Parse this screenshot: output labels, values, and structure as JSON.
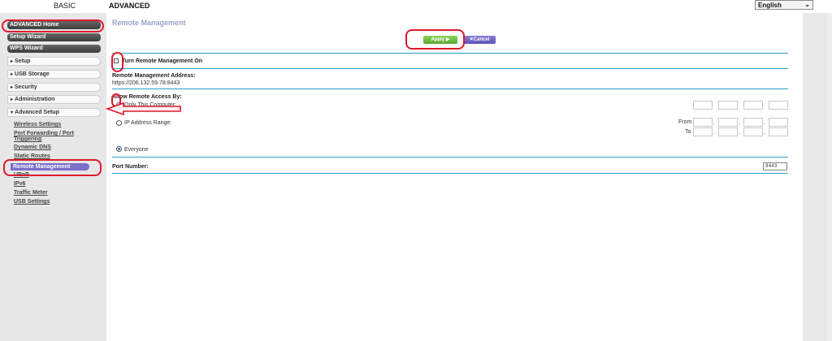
{
  "tabs": {
    "basic": "BASIC",
    "advanced": "ADVANCED"
  },
  "language": {
    "selected": "English"
  },
  "sidebar": {
    "dark_buttons": [
      "ADVANCED Home",
      "Setup Wizard",
      "WPS Wizard"
    ],
    "menu": [
      {
        "label": "Setup",
        "arrow": "▸"
      },
      {
        "label": "USB Storage",
        "arrow": "▸"
      },
      {
        "label": "Security",
        "arrow": "▸"
      },
      {
        "label": "Administration",
        "arrow": "▸"
      },
      {
        "label": "Advanced Setup",
        "arrow": "▾"
      }
    ],
    "sub_items": [
      "Wireless Settings",
      "Port Forwarding / Port",
      "Triggering",
      "Dynamic DNS",
      "Static Routes",
      "Remote Management",
      "UPnP",
      "IPv6",
      "Traffic Meter",
      "USB Settings"
    ]
  },
  "main": {
    "title": "Remote Management",
    "apply_label": "Apply ▶",
    "cancel_label": "✕Cancel",
    "turn_on_label": "Turn Remote Management On",
    "turn_on_checked": false,
    "address_label": "Remote Management Address:",
    "address_value": "https://206.132.59.78:8443",
    "access_label": "Allow Remote Access By:",
    "options": [
      "Only This Computer:",
      "IP Address Range:",
      "Everyone"
    ],
    "selected_option": "Everyone",
    "from_label": "From",
    "to_label": "To",
    "port_label": "Port Number:",
    "port_value": "8443"
  },
  "colors": {
    "accent": "#2aa0c6",
    "apply": "#6cbf3c",
    "cancel": "#6a5fc2",
    "annotation": "#e0182c",
    "active_item": "#7a6fc9"
  }
}
